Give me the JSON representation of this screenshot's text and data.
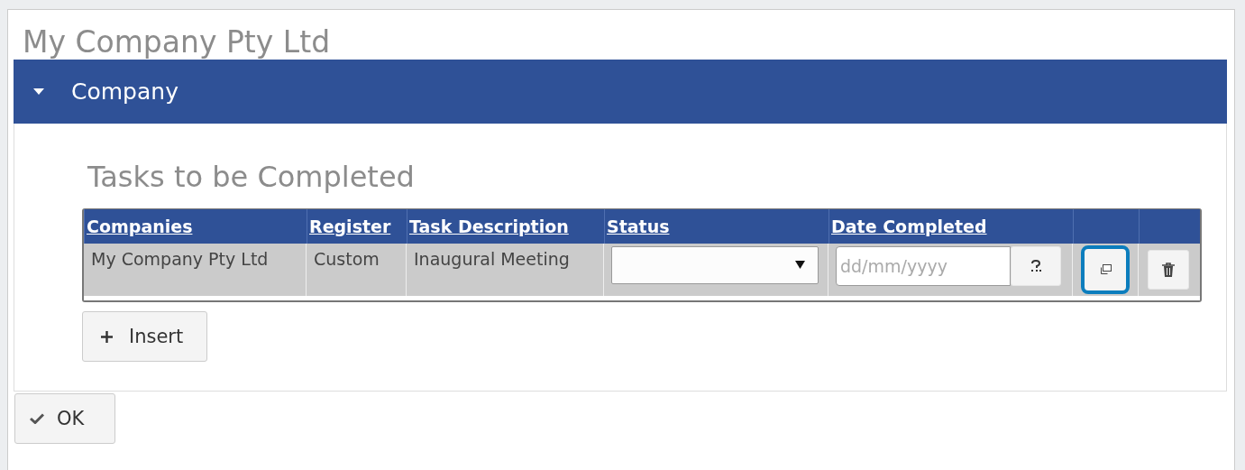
{
  "window": {
    "title": "My Company Pty Ltd"
  },
  "panel": {
    "title": "Company",
    "expanded": true
  },
  "section": {
    "title": "Tasks to be Completed"
  },
  "table": {
    "columns": [
      "Companies",
      "Register",
      "Task Description",
      "Status",
      "Date Completed"
    ],
    "rows": [
      {
        "company": "My Company Pty Ltd",
        "register": "Custom",
        "task": "Inaugural Meeting",
        "date": {
          "placeholder": "dd/mm/yyyy"
        },
        "copy_focused": true
      }
    ]
  },
  "insert_button": {
    "label": "Insert"
  },
  "ok_button": {
    "label": "OK"
  }
}
